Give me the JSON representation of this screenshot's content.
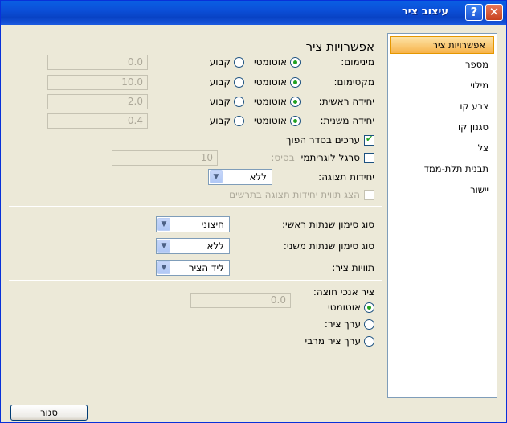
{
  "window": {
    "title": "עיצוב ציר",
    "help_glyph": "?",
    "close_glyph": "✕"
  },
  "sidebar": {
    "items": [
      {
        "label": "אפשרויות ציר"
      },
      {
        "label": "מספר"
      },
      {
        "label": "מילוי"
      },
      {
        "label": "צבע קו"
      },
      {
        "label": "סגנון קו"
      },
      {
        "label": "צל"
      },
      {
        "label": "תבנית תלת-ממד"
      },
      {
        "label": "יישור"
      }
    ],
    "selected_index": 0
  },
  "axis_options": {
    "title": "אפשרויות ציר",
    "auto_label": "אוטומטי",
    "fixed_label": "קבוע",
    "rows": [
      {
        "label": "מינימום:",
        "value": "0.0"
      },
      {
        "label": "מקסימום:",
        "value": "10.0"
      },
      {
        "label": "יחידה ראשית:",
        "value": "2.0"
      },
      {
        "label": "יחידה משנית:",
        "value": "0.4"
      }
    ],
    "reverse_order": {
      "label": "ערכים בסדר הפוך",
      "checked": true
    },
    "log_scale": {
      "label": "סרגל לוגריתמי",
      "base_label": "בסיס:",
      "base_value": "10",
      "checked": false
    },
    "display_units": {
      "label": "יחידות תצוגה:",
      "value": "ללא"
    },
    "show_units_label": {
      "label": "הצג תווית יחידות תצוגה בתרשים",
      "checked": false
    },
    "major_tick": {
      "label": "סוג סימון שנתות ראשי:",
      "value": "חיצוני"
    },
    "minor_tick": {
      "label": "סוג סימון שנתות משני:",
      "value": "ללא"
    },
    "axis_labels": {
      "label": "תוויות ציר:",
      "value": "ליד הציר"
    },
    "crosses": {
      "label": "ציר אנכי חוצה:",
      "auto": "אוטומטי",
      "axis_value_label": "ערך ציר:",
      "axis_value": "0.0",
      "max_value_label": "ערך ציר מרבי"
    }
  },
  "footer": {
    "close_label": "סגור"
  }
}
